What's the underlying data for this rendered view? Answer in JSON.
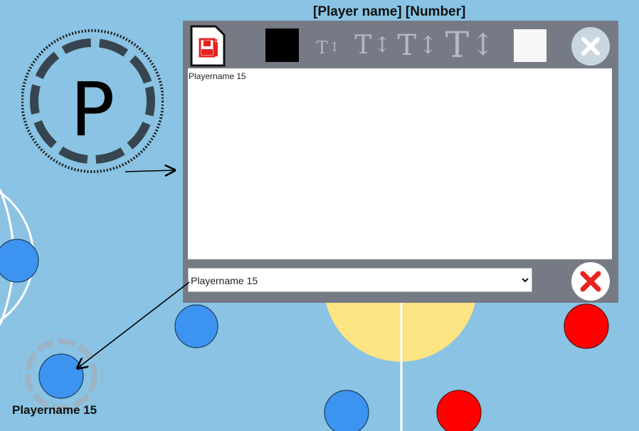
{
  "header": {
    "title": "[Player name] [Number]"
  },
  "editor": {
    "text_content": "Playername 15",
    "select_value": "Playername 15",
    "toolbar": {
      "save_icon": "save-floppy-icon",
      "color_black": "#000000",
      "color_white": "#f8f8f8",
      "font_size_glyph": "T",
      "font_size_arrow": "↕"
    }
  },
  "player_icon": {
    "letter": "P"
  },
  "player_label": "Playername 15",
  "colors": {
    "court": "#8ac3e3",
    "team_blue": "#3d94f0",
    "team_red": "#ff0000",
    "center_circle": "#fde483",
    "dialog_bg": "#767a85",
    "close_red": "#e8241f"
  }
}
